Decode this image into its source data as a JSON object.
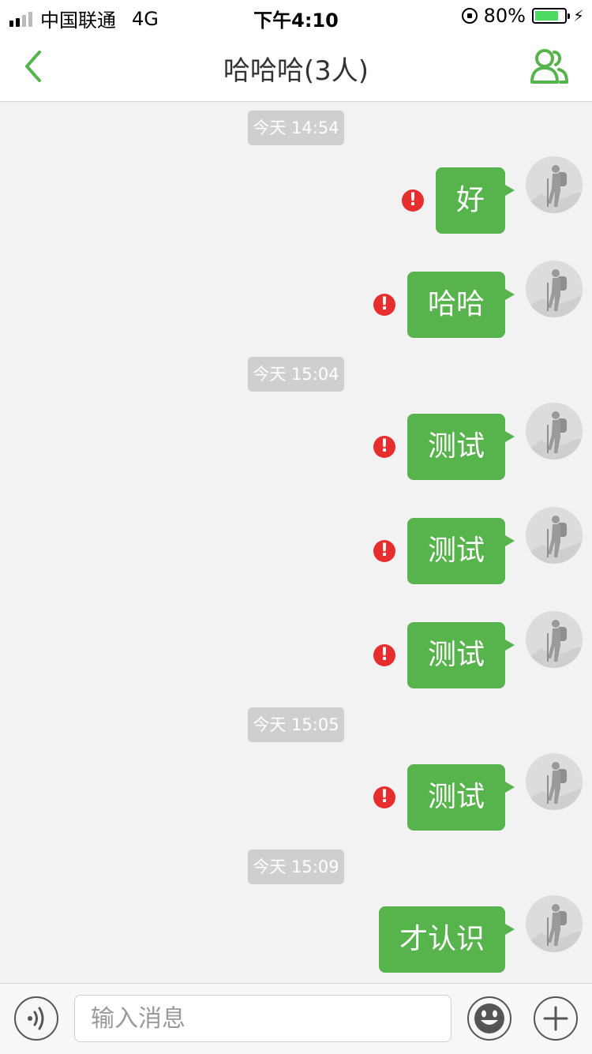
{
  "status_bar": {
    "carrier": "中国联通",
    "network": "4G",
    "time": "下午4:10",
    "battery_percent": "80%",
    "battery_level": 0.8
  },
  "nav": {
    "title": "哈哈哈(3人)",
    "back_icon": "chevron-left-icon",
    "group_icon": "group-members-icon"
  },
  "timestamps": [
    "今天 14:54",
    "今天 15:04",
    "今天 15:05",
    "今天 15:09"
  ],
  "messages": [
    {
      "text": "好",
      "failed": true
    },
    {
      "text": "哈哈",
      "failed": true
    },
    {
      "text": "测试",
      "failed": true
    },
    {
      "text": "测试",
      "failed": true
    },
    {
      "text": "测试",
      "failed": true
    },
    {
      "text": "测试",
      "failed": true
    },
    {
      "text": "才认识",
      "failed": false
    }
  ],
  "error_mark": "!",
  "input": {
    "placeholder": "输入消息",
    "value": ""
  },
  "colors": {
    "accent": "#57b34b",
    "error": "#e62e2e",
    "background": "#f2f2f2"
  }
}
